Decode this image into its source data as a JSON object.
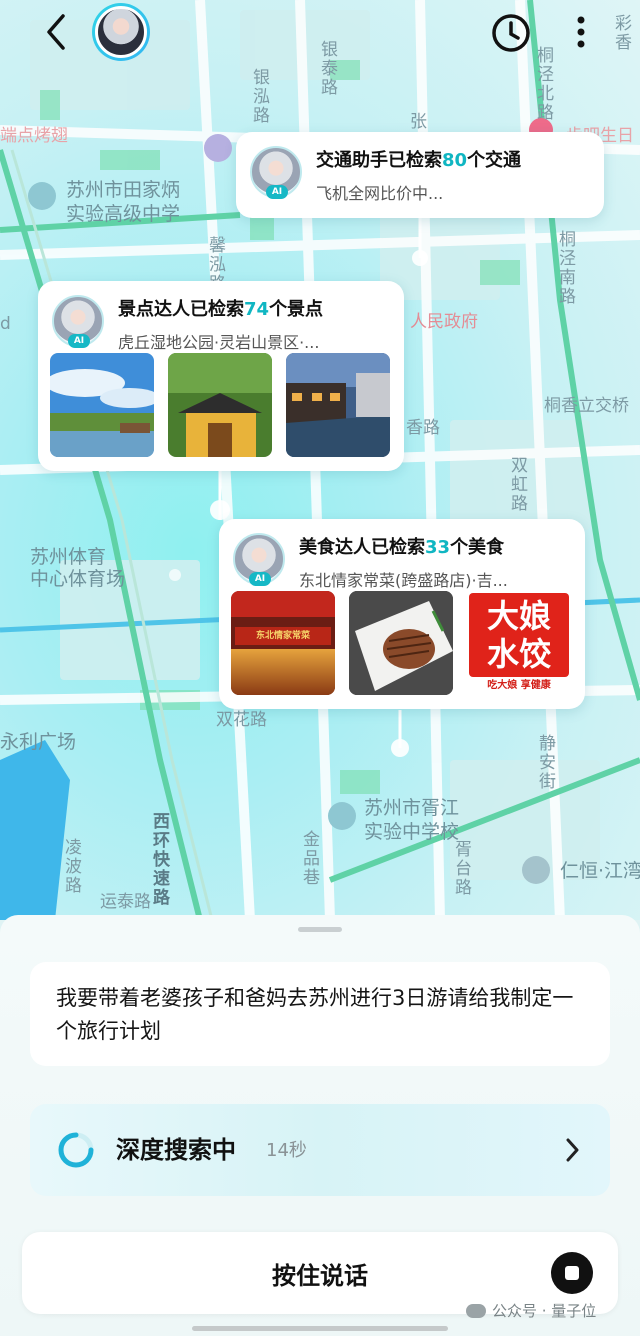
{
  "header": {
    "back_icon": "chevron-left-icon",
    "history_icon": "clock-icon",
    "more_icon": "vertical-dots-icon"
  },
  "map": {
    "labels": {
      "street_yintai": "银泰路",
      "street_yinhong": "银泓路",
      "street_tongjing_n": "桐泾北路",
      "street_tongjing_s": "桐泾南路",
      "street_xinhong": "馨泓路",
      "zhang": "张",
      "cai": "彩香",
      "poi_kaochi": "端点烤翅",
      "poi_shengri": "步吧生日",
      "school_tianjia": "苏州市田家炳\n实验高级中学",
      "renmin": "人民政府",
      "bridge_tongxiang": "桐香立交桥",
      "shuanghong": "双虹路",
      "poi_xiang": "香路",
      "center_left": "苏州体育\n中心体育场",
      "yongli": "永利广场",
      "shuanghua": "双花路",
      "school_xujiang": "苏州市胥江\n实验中学校",
      "jingan": "静安街",
      "renheng": "仁恒·江湾",
      "lingbo": "凌波路",
      "yuntai": "运泰路",
      "xihuan": "西环快速路",
      "jinpin": "金品巷",
      "xutai": "胥台路",
      "left_d": "d"
    }
  },
  "cards": {
    "transport": {
      "title_prefix": "交通助手已检索",
      "count": "80",
      "title_suffix": "个交通",
      "subtitle": "飞机全网比价中...",
      "ai_badge": "AI"
    },
    "scenic": {
      "title_prefix": "景点达人已检索",
      "count": "74",
      "title_suffix": "个景点",
      "subtitle": "虎丘湿地公园·灵岩山景区·...",
      "ai_badge": "AI"
    },
    "food": {
      "title_prefix": "美食达人已检索",
      "count": "33",
      "title_suffix": "个美食",
      "subtitle": "东北情家常菜(跨盛路店)·吉...",
      "ai_badge": "AI",
      "sign_text": "东北情家常菜",
      "logo_line1": "大娘",
      "logo_line2": "水饺",
      "logo_slogan": "吃大娘 享健康"
    }
  },
  "panel": {
    "user_message": "我要带着老婆孩子和爸妈去苏州进行3日游请给我制定一个旅行计划",
    "search_status": "深度搜索中",
    "search_time": "14秒",
    "talk_button": "按住说话",
    "watermark": "公众号 · 量子位"
  },
  "colors": {
    "accent": "#10b6c2",
    "road_green": "#5fd2a6"
  }
}
